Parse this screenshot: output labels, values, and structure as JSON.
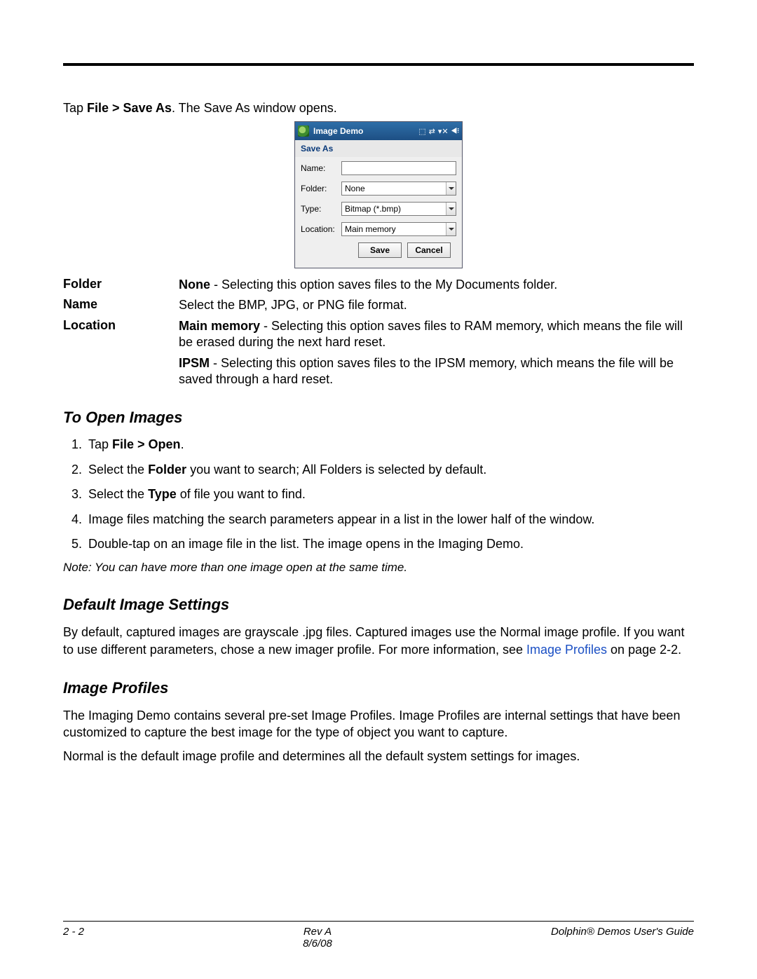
{
  "intro": {
    "prefix": "Tap ",
    "bold": "File > Save As",
    "suffix": ". The Save As window opens."
  },
  "device": {
    "title": "Image Demo",
    "section": "Save As",
    "labels": {
      "name": "Name:",
      "folder": "Folder:",
      "type": "Type:",
      "location": "Location:"
    },
    "values": {
      "name": "",
      "folder": "None",
      "type": "Bitmap (*.bmp)",
      "location": "Main memory"
    },
    "buttons": {
      "save": "Save",
      "cancel": "Cancel"
    }
  },
  "descriptions": {
    "folder_term": "Folder",
    "folder_def_bold": "None",
    "folder_def_rest": " - Selecting this option saves files to the My Documents folder.",
    "name_term": "Name",
    "name_def": "Select the BMP, JPG, or PNG file format.",
    "location_term": "Location",
    "location_def1_bold": "Main memory",
    "location_def1_rest": " - Selecting this option saves files to RAM memory, which means the file will be erased during the next hard reset.",
    "location_def2_bold": "IPSM",
    "location_def2_rest": " - Selecting this option saves files to the IPSM memory, which means the file will be saved through a hard reset."
  },
  "sections": {
    "open": {
      "heading": "To Open Images",
      "steps": [
        {
          "pre": "Tap ",
          "b": "File > Open",
          "post": "."
        },
        {
          "pre": "Select the ",
          "b": "Folder",
          "post": " you want to search; All Folders is selected by default."
        },
        {
          "pre": "Select the ",
          "b": "Type",
          "post": " of file you want to find."
        },
        {
          "pre": "",
          "b": "",
          "post": "Image files matching the search parameters appear in a list in the lower half of the window."
        },
        {
          "pre": "",
          "b": "",
          "post": "Double-tap on an image file in the list. The image opens in the Imaging Demo."
        }
      ],
      "note": "Note: You can have more than one image open at the same time."
    },
    "default_settings": {
      "heading": "Default Image Settings",
      "para_pre": "By default, captured images are grayscale .jpg files. Captured images use the Normal image profile. If you want to use different parameters, chose a new imager profile. For more information, see ",
      "link": "Image Profiles",
      "para_post": " on page 2-2."
    },
    "profiles": {
      "heading": "Image Profiles",
      "p1": "The Imaging Demo contains several pre-set Image Profiles. Image Profiles are internal settings that have been customized to capture the best image for the type of object you want to capture.",
      "p2": "Normal is the default image profile and determines all the default system settings for images."
    }
  },
  "footer": {
    "left": "2 - 2",
    "center1": "Rev A",
    "center2": "8/6/08",
    "right": "Dolphin® Demos User's Guide"
  }
}
